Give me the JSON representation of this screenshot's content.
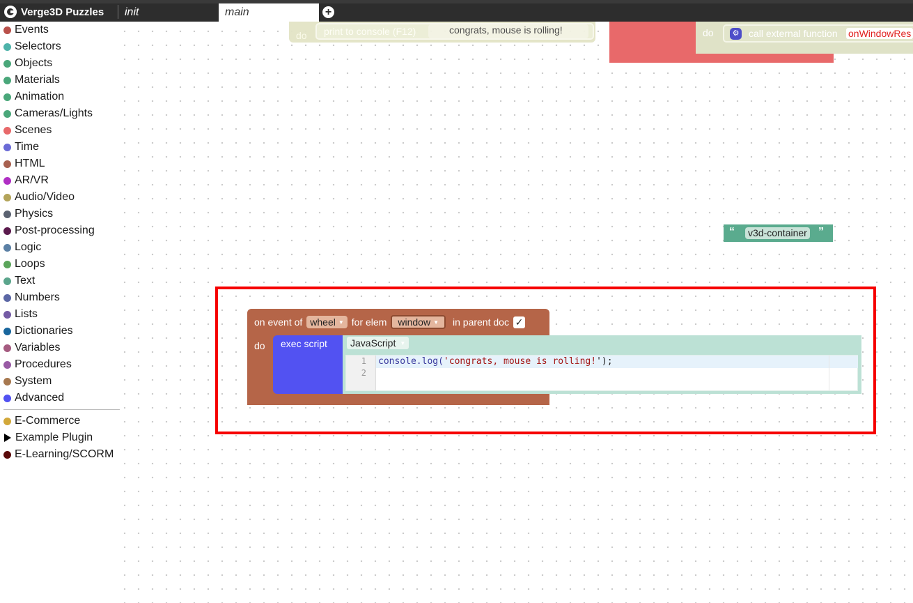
{
  "app": {
    "title": "Verge3D Puzzles"
  },
  "tabs": [
    {
      "label": "init"
    },
    {
      "label": "main"
    }
  ],
  "sidebar": {
    "categories": [
      {
        "label": "Events",
        "color": "#b9504a"
      },
      {
        "label": "Selectors",
        "color": "#4eb3aa"
      },
      {
        "label": "Objects",
        "color": "#4aa77a"
      },
      {
        "label": "Materials",
        "color": "#4aa77a"
      },
      {
        "label": "Animation",
        "color": "#4aa77a"
      },
      {
        "label": "Cameras/Lights",
        "color": "#4aa77a"
      },
      {
        "label": "Scenes",
        "color": "#e8696a"
      },
      {
        "label": "Time",
        "color": "#6b6bd6"
      },
      {
        "label": "HTML",
        "color": "#a86150"
      },
      {
        "label": "AR/VR",
        "color": "#b02fc4"
      },
      {
        "label": "Audio/Video",
        "color": "#b3a45a"
      },
      {
        "label": "Physics",
        "color": "#5b6271"
      },
      {
        "label": "Post-processing",
        "color": "#5b1a4d"
      },
      {
        "label": "Logic",
        "color": "#5b80a5"
      },
      {
        "label": "Loops",
        "color": "#5ba55b"
      },
      {
        "label": "Text",
        "color": "#5ba58c"
      },
      {
        "label": "Numbers",
        "color": "#5b67a5"
      },
      {
        "label": "Lists",
        "color": "#745ba5"
      },
      {
        "label": "Dictionaries",
        "color": "#19669d"
      },
      {
        "label": "Variables",
        "color": "#a55b80"
      },
      {
        "label": "Procedures",
        "color": "#995ba5"
      },
      {
        "label": "System",
        "color": "#a7784f"
      },
      {
        "label": "Advanced",
        "color": "#5252f2"
      }
    ],
    "plugins": [
      {
        "label": "E-Commerce",
        "color": "#d2a83a",
        "type": "dot"
      },
      {
        "label": "Example Plugin",
        "color": "#000000",
        "type": "triangle"
      },
      {
        "label": "E-Learning/SCORM",
        "color": "#5a0a0a",
        "type": "dot"
      }
    ]
  },
  "workspace": {
    "ghost_print": {
      "do_label": "do",
      "print_label": "print to console (F12)",
      "text": "congrats, mouse is rolling!"
    },
    "call_external": {
      "do_label": "do",
      "label": "call external function",
      "value": "onWindowRes"
    },
    "text_block": {
      "value": "v3d-container",
      "open_quote": "“",
      "close_quote": "”"
    },
    "event_block": {
      "prefix": "on event of",
      "event": "wheel",
      "for_label": "for elem",
      "elem": "window",
      "parent_label": "in parent doc",
      "parent_checked": "✓",
      "do_label": "do"
    },
    "exec_script": {
      "label": "exec script",
      "language": "JavaScript",
      "line_numbers": [
        "1",
        "2"
      ],
      "code_line1_fn": "console.log(",
      "code_line1_str": "'congrats, mouse is rolling!",
      "code_line1_end": "');"
    }
  },
  "colors": {
    "highlight": "#f60000",
    "event_block": "#b56548",
    "exec_block": "#5252f2"
  }
}
